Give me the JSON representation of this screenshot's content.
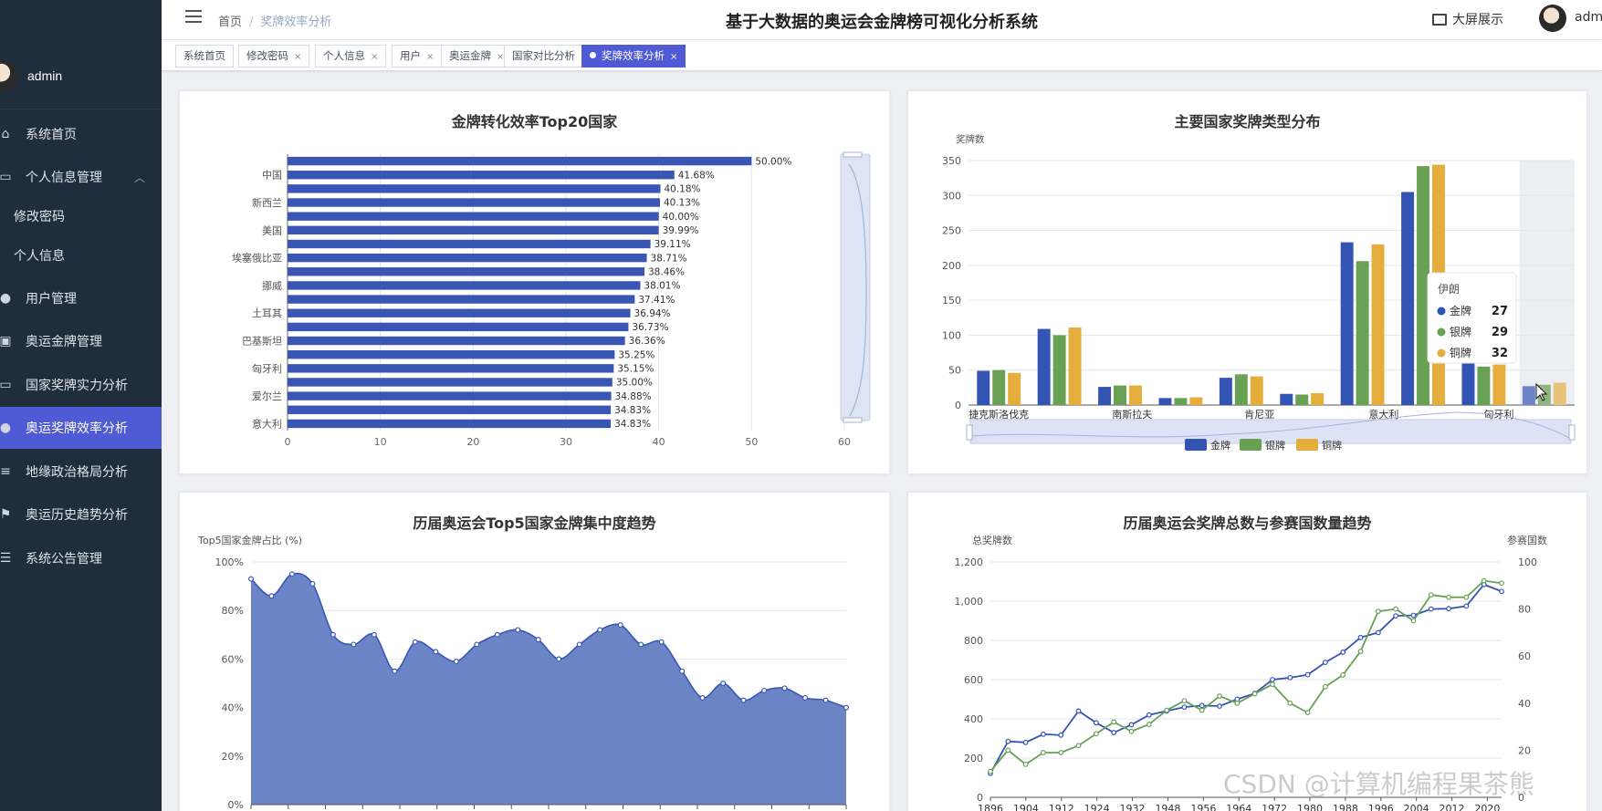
{
  "header": {
    "breadcrumb": [
      "首页",
      "奖牌效率分析"
    ],
    "title": "基于大数据的奥运会金牌榜可视化分析系统",
    "bigscreen_label": "大屏展示",
    "user": "admin"
  },
  "sidebar": {
    "user": "admin",
    "items": [
      {
        "label": "系统首页",
        "icon": "home-icon"
      },
      {
        "label": "个人信息管理",
        "icon": "id-card-icon"
      },
      {
        "label": "修改密码",
        "icon": ""
      },
      {
        "label": "个人信息",
        "icon": ""
      },
      {
        "label": "用户管理",
        "icon": "user-icon"
      },
      {
        "label": "奥运金牌管理",
        "icon": "clipboard-icon"
      },
      {
        "label": "国家奖牌实力分析",
        "icon": "monitor-icon"
      },
      {
        "label": "奥运奖牌效率分析",
        "icon": "bulb-icon"
      },
      {
        "label": "地缘政治格局分析",
        "icon": "sliders-icon"
      },
      {
        "label": "奥运历史趋势分析",
        "icon": "flag-icon"
      },
      {
        "label": "系统公告管理",
        "icon": "list-icon"
      }
    ]
  },
  "tags": [
    {
      "label": "系统首页",
      "closable": false
    },
    {
      "label": "修改密码",
      "closable": true
    },
    {
      "label": "个人信息",
      "closable": true
    },
    {
      "label": "用户",
      "closable": true
    },
    {
      "label": "奥运金牌",
      "closable": true
    },
    {
      "label": "国家对比分析",
      "closable": true
    },
    {
      "label": "奖牌效率分析",
      "closable": true
    }
  ],
  "colors": {
    "gold": "#3454b4",
    "silver": "#68a054",
    "bronze": "#e5ad3c",
    "accent": "#4f5bd5"
  },
  "watermark": "CSDN @计算机编程果茶熊",
  "chart_data": [
    {
      "id": "efficiency",
      "type": "bar",
      "orientation": "horizontal",
      "title": "金牌转化效率Top20国家",
      "xlim": [
        0,
        60
      ],
      "xticks": [
        0,
        10,
        20,
        30,
        40,
        50,
        60
      ],
      "category_labels_shown": [
        "中国",
        "新西兰",
        "美国",
        "埃塞俄比亚",
        "挪威",
        "土耳其",
        "巴基斯坦",
        "匈牙利",
        "爱尔兰",
        "意大利"
      ],
      "values": [
        50.0,
        41.68,
        40.18,
        40.13,
        40.0,
        39.99,
        39.11,
        38.71,
        38.46,
        38.01,
        37.41,
        36.94,
        36.73,
        36.36,
        35.25,
        35.15,
        35.0,
        34.88,
        34.83,
        34.83
      ],
      "value_labels": [
        "50.00%",
        "41.68%",
        "40.18%",
        "40.13%",
        "40.00%",
        "39.99%",
        "39.11%",
        "38.71%",
        "38.46%",
        "38.01%",
        "37.41%",
        "36.94%",
        "36.73%",
        "36.36%",
        "35.25%",
        "35.15%",
        "35.00%",
        "34.88%",
        "34.83%",
        "34.83%"
      ]
    },
    {
      "id": "medal-types",
      "type": "bar",
      "title": "主要国家奖牌类型分布",
      "ylabel": "奖牌数",
      "ylim": [
        0,
        350
      ],
      "yticks": [
        0,
        50,
        100,
        150,
        200,
        250,
        300,
        350
      ],
      "x_labels_shown": [
        "捷克斯洛伐克",
        "南斯拉夫",
        "肯尼亚",
        "意大利",
        "匈牙利"
      ],
      "series": [
        {
          "name": "金牌",
          "values": [
            49,
            109,
            26,
            10,
            39,
            16,
            233,
            305,
            60,
            27
          ]
        },
        {
          "name": "银牌",
          "values": [
            50,
            100,
            28,
            10,
            44,
            15,
            206,
            342,
            55,
            29
          ]
        },
        {
          "name": "铜牌",
          "values": [
            46,
            111,
            28,
            11,
            41,
            17,
            230,
            344,
            58,
            32
          ]
        }
      ],
      "legend": [
        "金牌",
        "银牌",
        "铜牌"
      ],
      "tooltip": {
        "title": "伊朗",
        "rows": [
          {
            "name": "金牌",
            "value": "27"
          },
          {
            "name": "银牌",
            "value": "29"
          },
          {
            "name": "铜牌",
            "value": "32"
          }
        ]
      }
    },
    {
      "id": "concentration",
      "type": "area",
      "title": "历届奥运会Top5国家金牌集中度趋势",
      "ylabel": "Top5国家金牌占比 (%)",
      "ylim": [
        0,
        100
      ],
      "ytick_labels": [
        "0%",
        "20%",
        "40%",
        "60%",
        "80%",
        "100%"
      ],
      "values": [
        93,
        86,
        95,
        91,
        70,
        66,
        70,
        55,
        67,
        63,
        59,
        66,
        70,
        72,
        68,
        60,
        66,
        72,
        74,
        66,
        67,
        55,
        44,
        50,
        43,
        47,
        48,
        44,
        43,
        40
      ]
    },
    {
      "id": "totals-nations",
      "type": "line",
      "title": "历届奥运会奖牌总数与参赛国数量趋势",
      "ylabel_left": "总奖牌数",
      "ylabel_right": "参赛国数",
      "ylim_left": [
        0,
        1200
      ],
      "ylim_right": [
        0,
        100
      ],
      "ytick_labels_left": [
        "0",
        "200",
        "400",
        "600",
        "800",
        "1,000",
        "1,200"
      ],
      "ytick_labels_right": [
        "0",
        "20",
        "40",
        "60",
        "80",
        "100"
      ],
      "xtick_labels": [
        "1896",
        "1904",
        "1912",
        "1924",
        "1932",
        "1948",
        "1956",
        "1964",
        "1972",
        "1980",
        "1988",
        "1996",
        "2004",
        "2012",
        "2020"
      ],
      "series": [
        {
          "name": "总奖牌数",
          "axis": "left",
          "values": [
            122,
            285,
            280,
            322,
            317,
            440,
            380,
            330,
            370,
            420,
            440,
            460,
            468,
            465,
            500,
            530,
            600,
            610,
            625,
            688,
            740,
            815,
            840,
            925,
            928,
            960,
            962,
            975,
            1085,
            1050
          ]
        },
        {
          "name": "参赛国数",
          "axis": "right",
          "values": [
            11,
            20,
            14,
            19,
            19,
            22,
            27,
            32,
            28,
            31,
            37,
            41,
            37,
            43,
            40,
            44,
            48,
            40,
            36,
            47,
            52,
            62,
            79,
            80,
            75,
            86,
            85,
            85,
            92,
            91
          ]
        }
      ]
    }
  ]
}
